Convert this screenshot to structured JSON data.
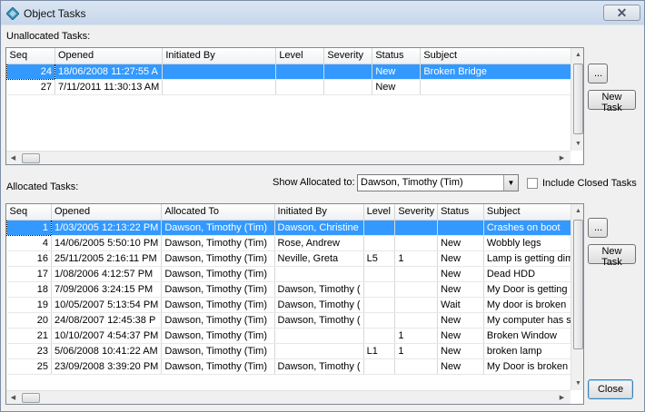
{
  "window": {
    "title": "Object Tasks",
    "close_glyph": "✕",
    "icon": "diamond-app-icon"
  },
  "unallocated": {
    "label": "Unallocated Tasks:",
    "columns": [
      "Seq",
      "Opened",
      "Initiated By",
      "Level",
      "Severity",
      "Status",
      "Subject"
    ],
    "rows": [
      [
        "24",
        "18/06/2008 11:27:55 A",
        "",
        "",
        "",
        "New",
        "Broken Bridge"
      ],
      [
        "27",
        "7/11/2011 11:30:13 AM",
        "",
        "",
        "",
        "New",
        ""
      ]
    ],
    "selected_row": 0,
    "ellipsis_label": "...",
    "new_task_label": "New Task"
  },
  "allocated": {
    "label": "Allocated Tasks:",
    "show_label": "Show Allocated to:",
    "show_value": "Dawson, Timothy (Tim)",
    "include_closed_label": "Include Closed Tasks",
    "include_closed_checked": false,
    "columns": [
      "Seq",
      "Opened",
      "Allocated To",
      "Initiated By",
      "Level",
      "Severity",
      "Status",
      "Subject"
    ],
    "rows": [
      [
        "1",
        "1/03/2005 12:13:22 PM",
        "Dawson, Timothy (Tim)",
        "Dawson, Christine",
        "",
        "",
        "",
        "Crashes on boot"
      ],
      [
        "4",
        "14/06/2005 5:50:10 PM",
        "Dawson, Timothy (Tim)",
        "Rose, Andrew",
        "",
        "",
        "New",
        "Wobbly legs"
      ],
      [
        "16",
        "25/11/2005 2:16:11 PM",
        "Dawson, Timothy (Tim)",
        "Neville, Greta",
        "L5",
        "1",
        "New",
        "Lamp is getting dim"
      ],
      [
        "17",
        "1/08/2006 4:12:57 PM",
        "Dawson, Timothy (Tim)",
        "",
        "",
        "",
        "New",
        "Dead HDD"
      ],
      [
        "18",
        "7/09/2006 3:24:15 PM",
        "Dawson, Timothy (Tim)",
        "Dawson, Timothy (",
        "",
        "",
        "New",
        "My Door is getting st"
      ],
      [
        "19",
        "10/05/2007 5:13:54 PM",
        "Dawson, Timothy (Tim)",
        "Dawson, Timothy (",
        "",
        "",
        "Wait",
        "My door is broken"
      ],
      [
        "20",
        "24/08/2007 12:45:38 P",
        "Dawson, Timothy (Tim)",
        "Dawson, Timothy (",
        "",
        "",
        "New",
        "My computer has sto"
      ],
      [
        "21",
        "10/10/2007 4:54:37 PM",
        "Dawson, Timothy (Tim)",
        "",
        "",
        "1",
        "New",
        "Broken Window"
      ],
      [
        "23",
        "5/06/2008 10:41:22 AM",
        "Dawson, Timothy (Tim)",
        "",
        "L1",
        "1",
        "New",
        "broken lamp"
      ],
      [
        "25",
        "23/09/2008 3:39:20 PM",
        "Dawson, Timothy (Tim)",
        "Dawson, Timothy (",
        "",
        "",
        "New",
        "My Door is broken"
      ]
    ],
    "selected_row": 0,
    "ellipsis_label": "...",
    "new_task_label": "New Task"
  },
  "close_label": "Close"
}
